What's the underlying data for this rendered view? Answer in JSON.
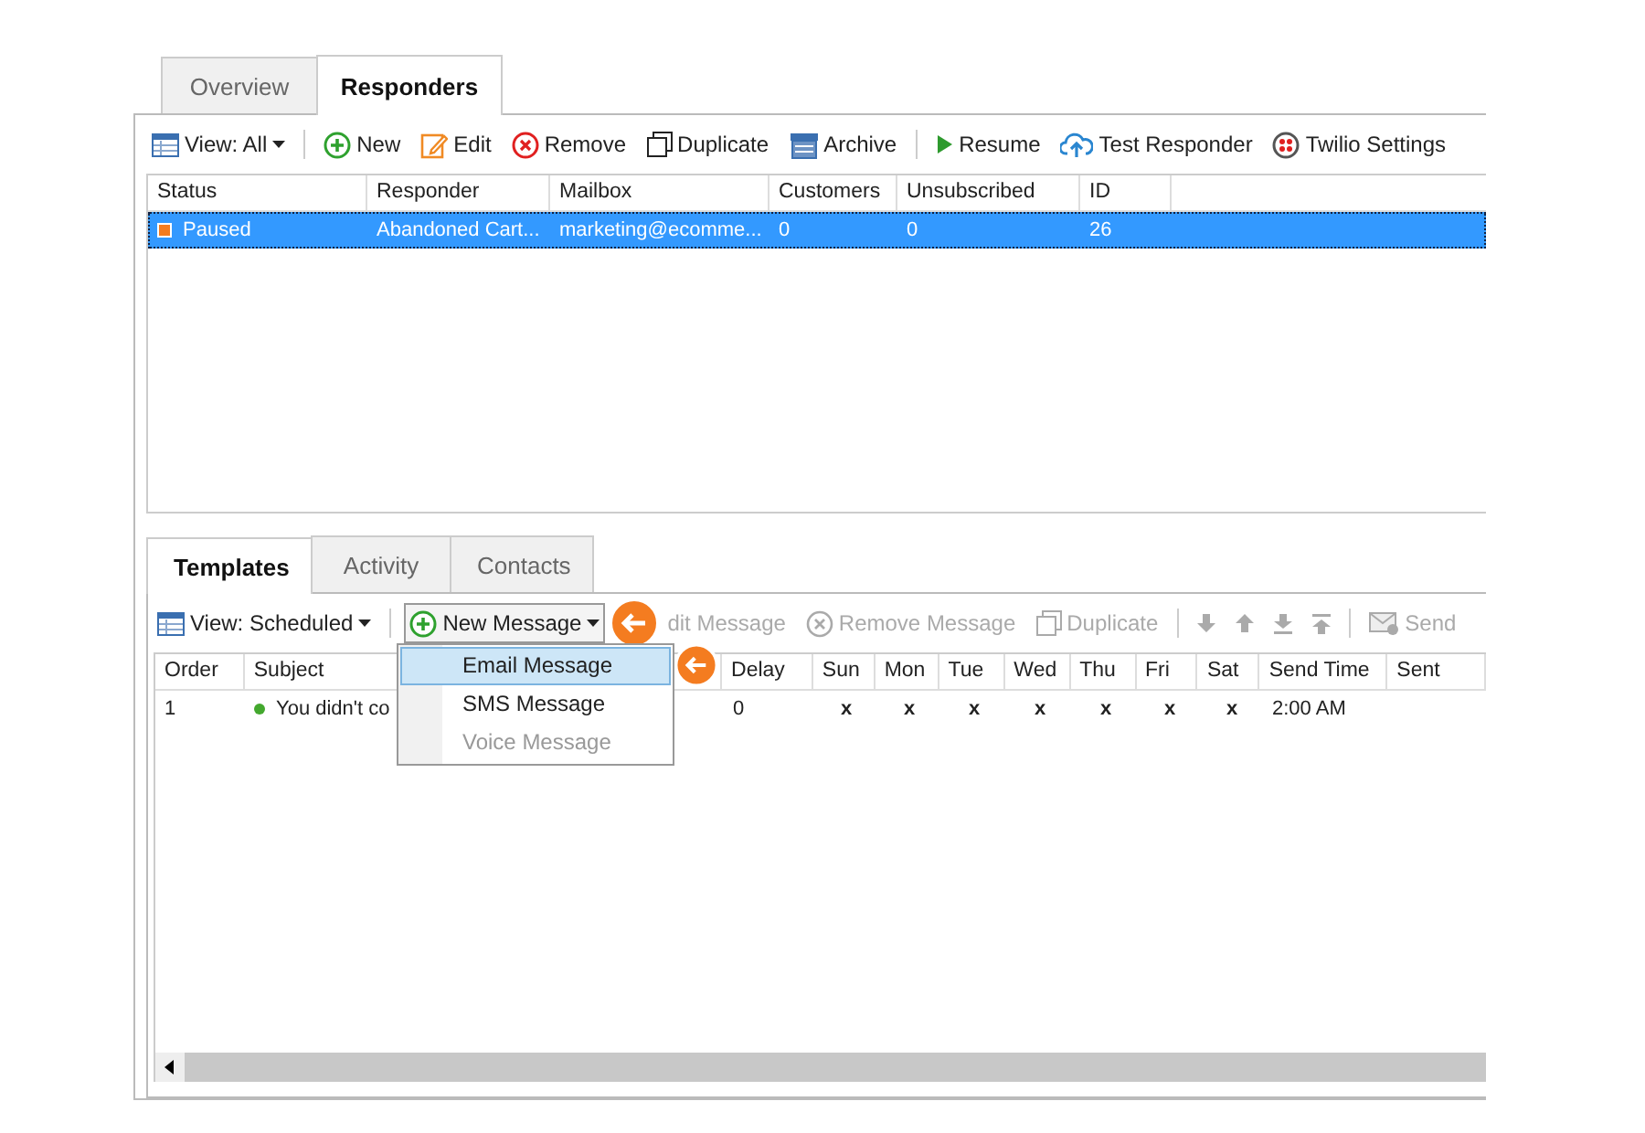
{
  "main_tabs": [
    {
      "label": "Overview",
      "selected": false
    },
    {
      "label": "Responders",
      "selected": true
    }
  ],
  "toolbar": [
    {
      "kind": "dropdown",
      "label": "View: All",
      "disabled": false
    },
    {
      "kind": "separator"
    },
    {
      "kind": "button",
      "label": "New",
      "disabled": false
    },
    {
      "kind": "button",
      "label": "Edit",
      "disabled": false
    },
    {
      "kind": "button",
      "label": "Remove",
      "disabled": false
    },
    {
      "kind": "button",
      "label": "Duplicate",
      "disabled": false
    },
    {
      "kind": "button",
      "label": "Archive",
      "disabled": false
    },
    {
      "kind": "separator"
    },
    {
      "kind": "button",
      "label": "Resume",
      "disabled": false
    },
    {
      "kind": "button",
      "label": "Test Responder",
      "disabled": false
    },
    {
      "kind": "button",
      "label": "Twilio Settings",
      "disabled": false
    }
  ],
  "responders": {
    "columns": [
      "Status",
      "Responder",
      "Mailbox",
      "Customers",
      "Unsubscribed",
      "ID"
    ],
    "rows": [
      {
        "selected": true,
        "cells": [
          "Paused",
          "Abandoned Cart...",
          "marketing@ecomme...",
          "0",
          "0",
          "26"
        ]
      }
    ]
  },
  "sub_tabs": [
    {
      "label": "Templates",
      "selected": true
    },
    {
      "label": "Activity",
      "selected": false
    },
    {
      "label": "Contacts",
      "selected": false
    }
  ],
  "sub_toolbar": [
    {
      "kind": "dropdown",
      "label": "View: Scheduled",
      "disabled": false
    },
    {
      "kind": "separator"
    },
    {
      "kind": "dropdown",
      "label": "New Message",
      "disabled": false,
      "open": true
    },
    {
      "kind": "button",
      "label": "dit Message",
      "disabled": true
    },
    {
      "kind": "button",
      "label": "Remove Message",
      "disabled": true
    },
    {
      "kind": "button",
      "label": "Duplicate",
      "disabled": true
    },
    {
      "kind": "separator"
    },
    {
      "kind": "icon",
      "disabled": true
    },
    {
      "kind": "icon",
      "disabled": true
    },
    {
      "kind": "icon",
      "disabled": true
    },
    {
      "kind": "icon",
      "disabled": true
    },
    {
      "kind": "separator"
    },
    {
      "kind": "button",
      "label": "Send",
      "disabled": true
    }
  ],
  "new_message_menu": [
    {
      "label": "Email Message",
      "selected": true,
      "disabled": false
    },
    {
      "label": "SMS Message",
      "selected": false,
      "disabled": false
    },
    {
      "label": "Voice Message",
      "selected": false,
      "disabled": true
    }
  ],
  "templates": {
    "columns": [
      "Order",
      "Subject",
      "Delay",
      "Sun",
      "Mon",
      "Tue",
      "Wed",
      "Thu",
      "Fri",
      "Sat",
      "Send Time",
      "Sent"
    ],
    "rows": [
      {
        "cells": [
          "1",
          "You didn't co",
          "0",
          "x",
          "x",
          "x",
          "x",
          "x",
          "x",
          "x",
          "2:00 AM"
        ]
      }
    ]
  }
}
